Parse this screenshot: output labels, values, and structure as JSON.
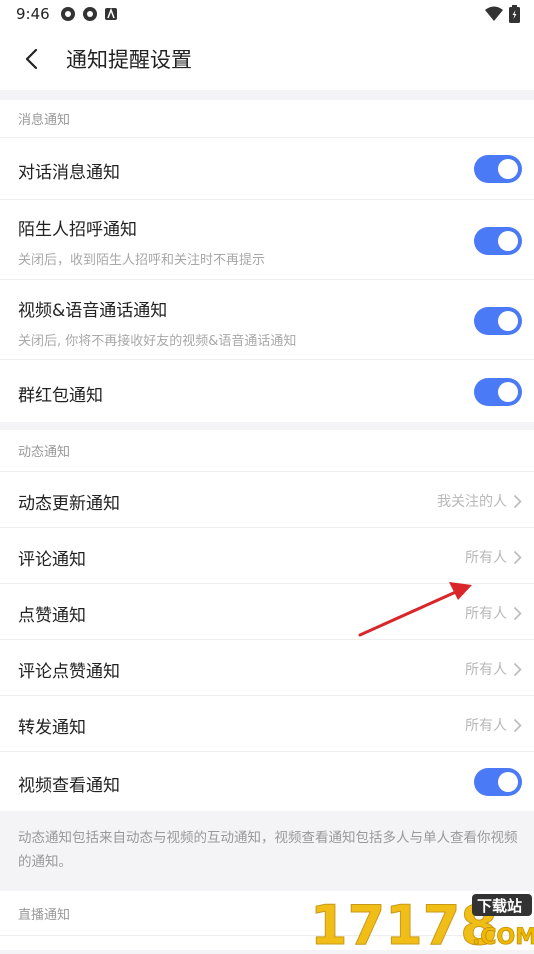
{
  "status_bar": {
    "time": "9:46"
  },
  "header": {
    "title": "通知提醒设置"
  },
  "sections": {
    "message": {
      "label": "消息通知"
    },
    "moments": {
      "label": "动态通知"
    },
    "live": {
      "label": "直播通知"
    }
  },
  "rows": {
    "chat": {
      "label": "对话消息通知",
      "toggle_on": true
    },
    "stranger": {
      "label": "陌生人招呼通知",
      "sub": "关闭后，收到陌生人招呼和关注时不再提示",
      "toggle_on": true
    },
    "call": {
      "label": "视频&语音通话通知",
      "sub": "关闭后, 你将不再接收好友的视频&语音通话通知",
      "toggle_on": true
    },
    "redpacket": {
      "label": "群红包通知",
      "toggle_on": true
    },
    "moment_update": {
      "label": "动态更新通知",
      "value": "我关注的人"
    },
    "comment": {
      "label": "评论通知",
      "value": "所有人"
    },
    "like": {
      "label": "点赞通知",
      "value": "所有人"
    },
    "comment_like": {
      "label": "评论点赞通知",
      "value": "所有人"
    },
    "forward": {
      "label": "转发通知",
      "value": "所有人"
    },
    "video_view": {
      "label": "视频查看通知",
      "toggle_on": true
    }
  },
  "footnote": "动态通知包括来自动态与视频的互动通知，视频查看通知包括多人与单人查看你视频的通知。",
  "watermark": {
    "number": "17178",
    "badge": "下载站",
    "domain": ".COM"
  },
  "colors": {
    "toggle_on": "#4a7af5",
    "arrow": "#d9262a",
    "watermark": "#f0b800"
  }
}
